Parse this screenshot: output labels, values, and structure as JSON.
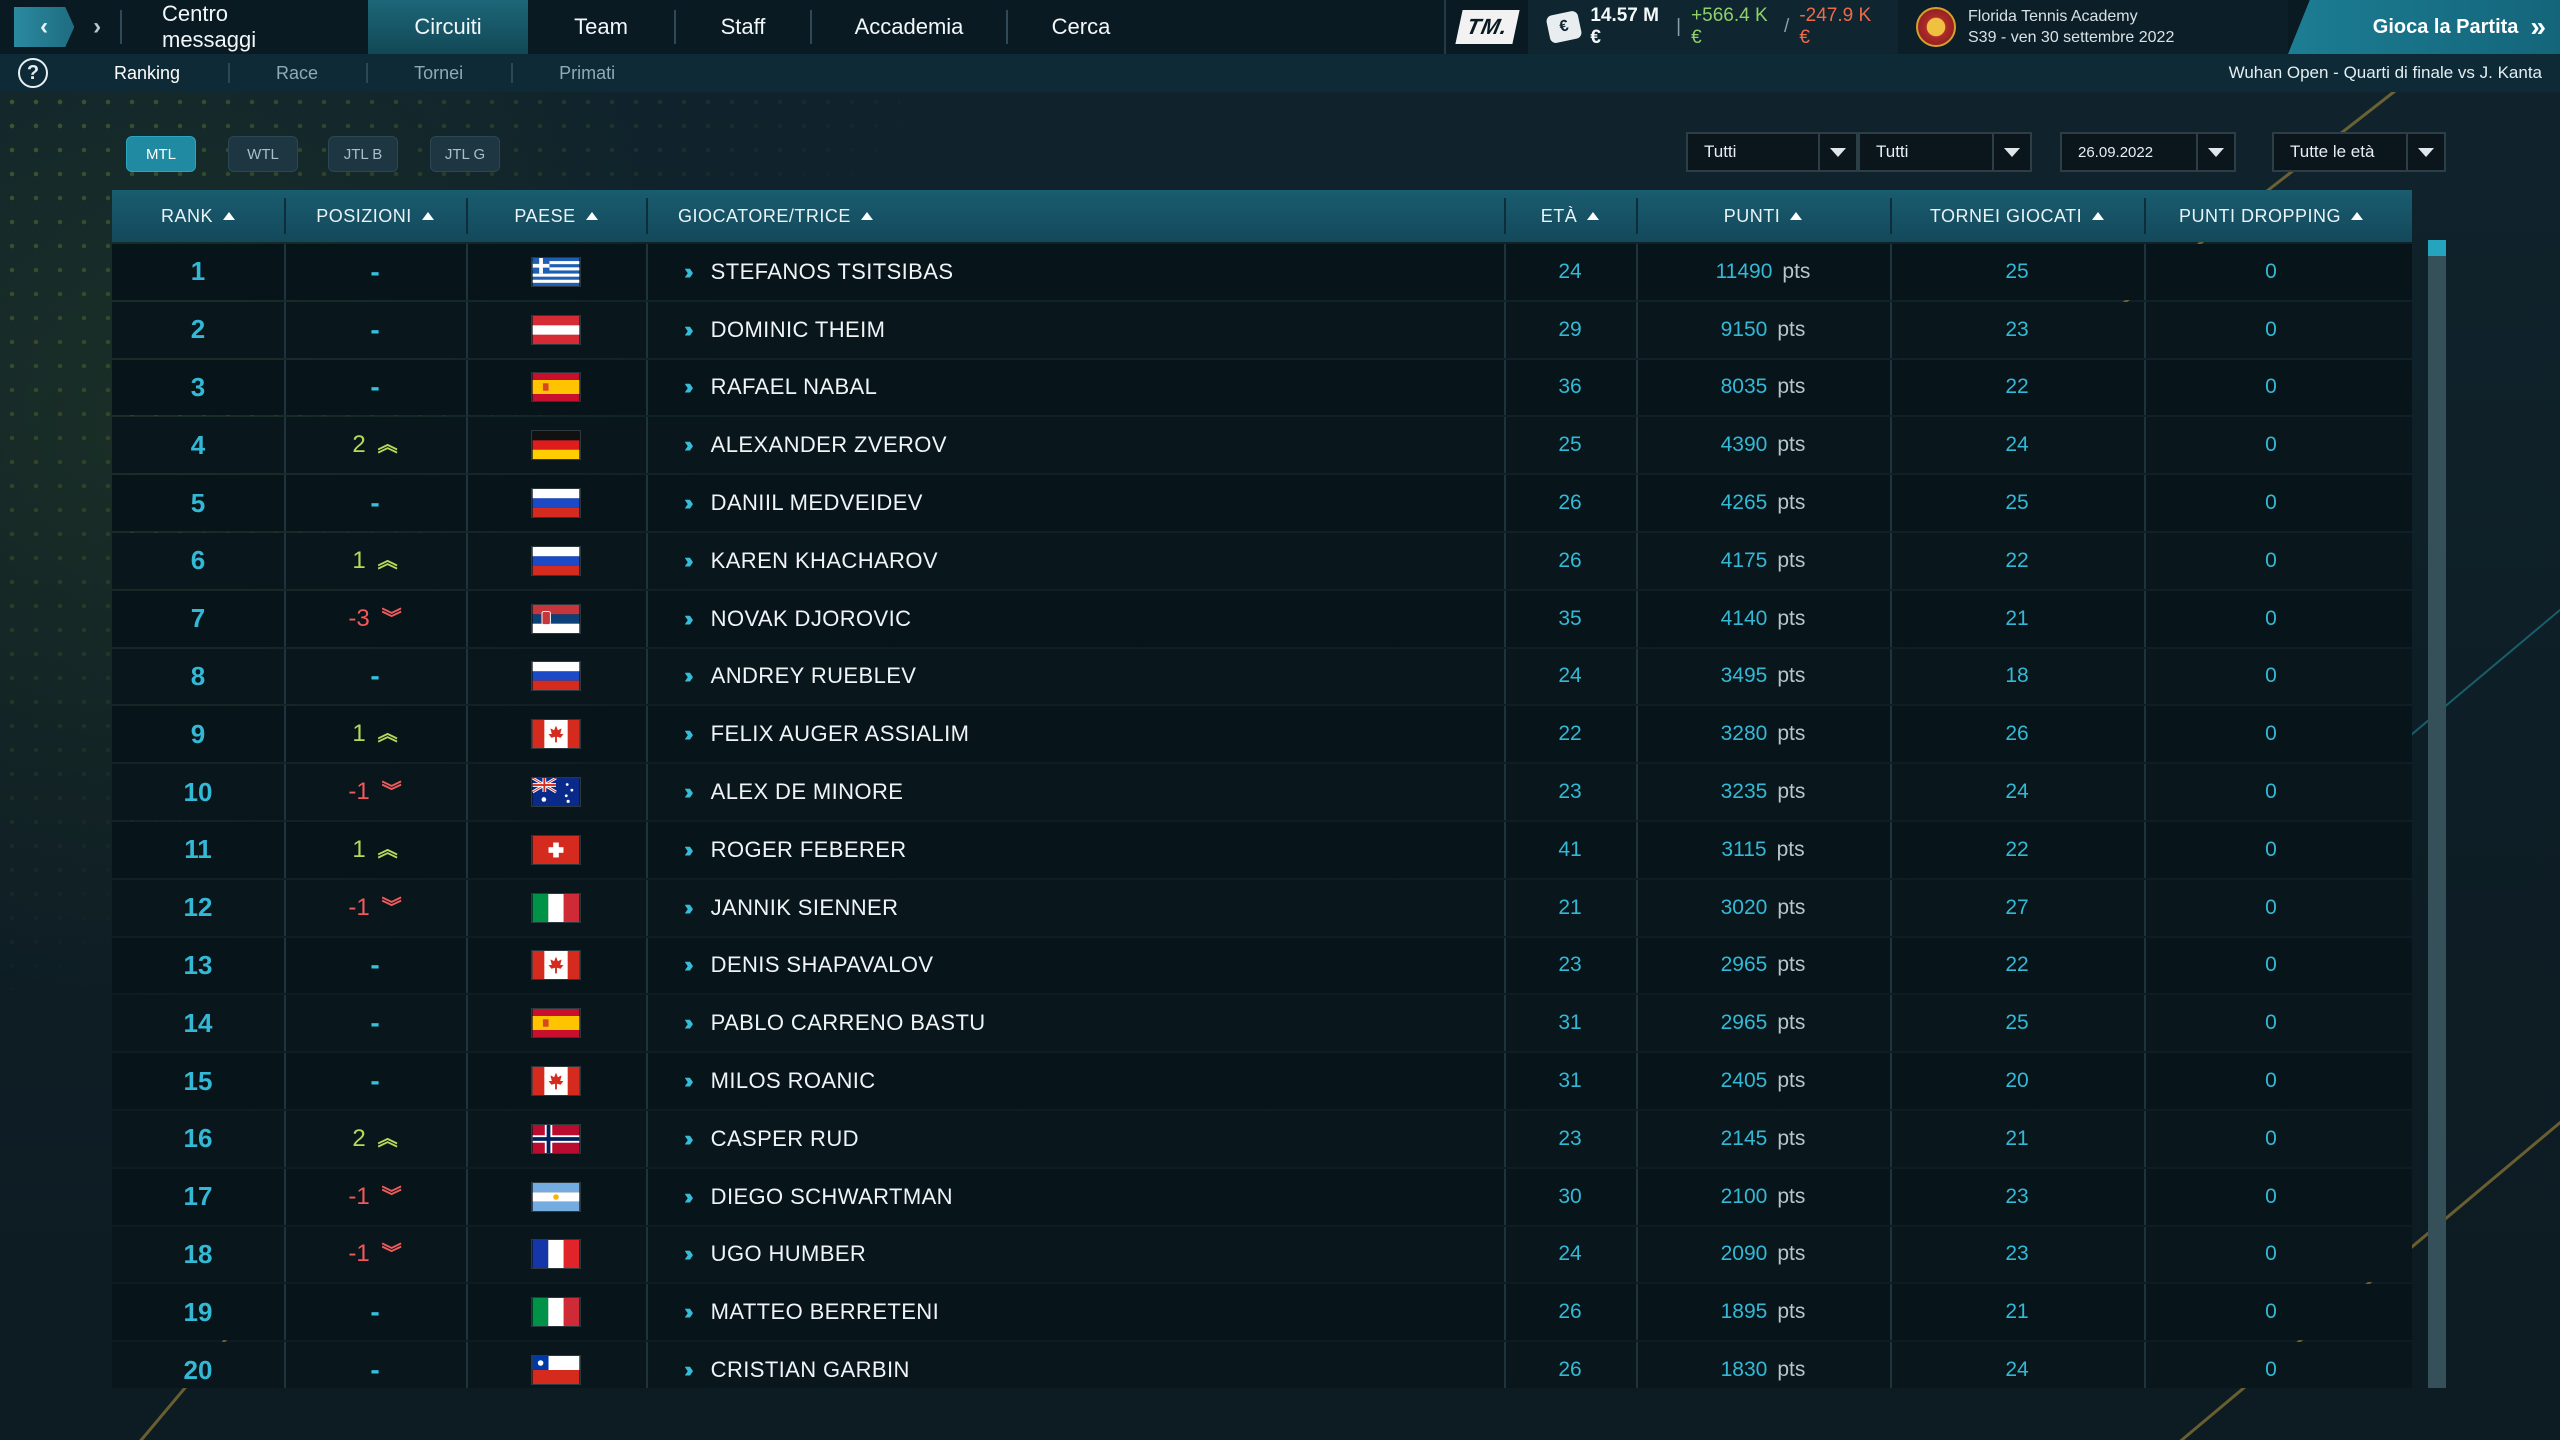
{
  "topbar": {
    "tabs": [
      {
        "label": "Centro messaggi",
        "active": false
      },
      {
        "label": "Circuiti",
        "active": true
      },
      {
        "label": "Team",
        "active": false
      },
      {
        "label": "Staff",
        "active": false
      },
      {
        "label": "Accademia",
        "active": false
      },
      {
        "label": "Cerca",
        "active": false
      }
    ],
    "logo_text": "TM.",
    "balance": "14.57 M €",
    "income": "+566.4 K €",
    "separator": "/",
    "expenses": "-247.9 K €",
    "academy_name": "Florida Tennis Academy",
    "date_line": "S39 - ven 30 settembre 2022",
    "play_label": "Gioca la Partita",
    "play_icon": "double-chevron-right-icon"
  },
  "subbar": {
    "help": "?",
    "tabs": [
      {
        "label": "Ranking",
        "active": true
      },
      {
        "label": "Race",
        "active": false
      },
      {
        "label": "Tornei",
        "active": false
      },
      {
        "label": "Primati",
        "active": false
      }
    ],
    "event": "Wuhan Open - Quarti di finale vs J. Kanta"
  },
  "filters": {
    "pills": [
      {
        "label": "MTL",
        "active": true
      },
      {
        "label": "WTL",
        "active": false
      },
      {
        "label": "JTL B",
        "active": false
      },
      {
        "label": "JTL G",
        "active": false
      }
    ],
    "dropdowns": [
      "Tutti",
      "Tutti",
      "26.09.2022",
      "Tutte le età"
    ]
  },
  "table": {
    "columns": [
      "RANK",
      "POSIZIONI",
      "PAESE",
      "GIOCATORE/TRICE",
      "ETÀ",
      "PUNTI",
      "TORNEI GIOCATI",
      "PUNTI DROPPING"
    ],
    "pts_unit": "pts",
    "rows": [
      {
        "rank": "1",
        "change": "-",
        "dir": "same",
        "flag": "GRC",
        "name": "STEFANOS TSITSIBAS",
        "age": "24",
        "points": "11490",
        "tournaments": "25",
        "dropping": "0"
      },
      {
        "rank": "2",
        "change": "-",
        "dir": "same",
        "flag": "AUT",
        "name": "DOMINIC THEIM",
        "age": "29",
        "points": "9150",
        "tournaments": "23",
        "dropping": "0"
      },
      {
        "rank": "3",
        "change": "-",
        "dir": "same",
        "flag": "ESP",
        "name": "RAFAEL NABAL",
        "age": "36",
        "points": "8035",
        "tournaments": "22",
        "dropping": "0"
      },
      {
        "rank": "4",
        "change": "2",
        "dir": "up",
        "flag": "DEU",
        "name": "ALEXANDER ZVEROV",
        "age": "25",
        "points": "4390",
        "tournaments": "24",
        "dropping": "0"
      },
      {
        "rank": "5",
        "change": "-",
        "dir": "same",
        "flag": "RUS",
        "name": "DANIIL MEDVEIDEV",
        "age": "26",
        "points": "4265",
        "tournaments": "25",
        "dropping": "0"
      },
      {
        "rank": "6",
        "change": "1",
        "dir": "up",
        "flag": "RUS",
        "name": "KAREN KHACHAROV",
        "age": "26",
        "points": "4175",
        "tournaments": "22",
        "dropping": "0"
      },
      {
        "rank": "7",
        "change": "-3",
        "dir": "down",
        "flag": "SRB",
        "name": "NOVAK DJOROVIC",
        "age": "35",
        "points": "4140",
        "tournaments": "21",
        "dropping": "0"
      },
      {
        "rank": "8",
        "change": "-",
        "dir": "same",
        "flag": "RUS",
        "name": "ANDREY RUEBLEV",
        "age": "24",
        "points": "3495",
        "tournaments": "18",
        "dropping": "0"
      },
      {
        "rank": "9",
        "change": "1",
        "dir": "up",
        "flag": "CAN",
        "name": "FELIX AUGER ASSIALIM",
        "age": "22",
        "points": "3280",
        "tournaments": "26",
        "dropping": "0"
      },
      {
        "rank": "10",
        "change": "-1",
        "dir": "down",
        "flag": "AUS",
        "name": "ALEX DE MINORE",
        "age": "23",
        "points": "3235",
        "tournaments": "24",
        "dropping": "0"
      },
      {
        "rank": "11",
        "change": "1",
        "dir": "up",
        "flag": "CHE",
        "name": "ROGER FEBERER",
        "age": "41",
        "points": "3115",
        "tournaments": "22",
        "dropping": "0"
      },
      {
        "rank": "12",
        "change": "-1",
        "dir": "down",
        "flag": "ITA",
        "name": "JANNIK SIENNER",
        "age": "21",
        "points": "3020",
        "tournaments": "27",
        "dropping": "0"
      },
      {
        "rank": "13",
        "change": "-",
        "dir": "same",
        "flag": "CAN",
        "name": "DENIS SHAPAVALOV",
        "age": "23",
        "points": "2965",
        "tournaments": "22",
        "dropping": "0"
      },
      {
        "rank": "14",
        "change": "-",
        "dir": "same",
        "flag": "ESP",
        "name": "PABLO CARRENO BASTU",
        "age": "31",
        "points": "2965",
        "tournaments": "25",
        "dropping": "0"
      },
      {
        "rank": "15",
        "change": "-",
        "dir": "same",
        "flag": "CAN",
        "name": "MILOS ROANIC",
        "age": "31",
        "points": "2405",
        "tournaments": "20",
        "dropping": "0"
      },
      {
        "rank": "16",
        "change": "2",
        "dir": "up",
        "flag": "NOR",
        "name": "CASPER RUD",
        "age": "23",
        "points": "2145",
        "tournaments": "21",
        "dropping": "0"
      },
      {
        "rank": "17",
        "change": "-1",
        "dir": "down",
        "flag": "ARG",
        "name": "DIEGO SCHWARTMAN",
        "age": "30",
        "points": "2100",
        "tournaments": "23",
        "dropping": "0"
      },
      {
        "rank": "18",
        "change": "-1",
        "dir": "down",
        "flag": "FRA",
        "name": "UGO HUMBER",
        "age": "24",
        "points": "2090",
        "tournaments": "23",
        "dropping": "0"
      },
      {
        "rank": "19",
        "change": "-",
        "dir": "same",
        "flag": "ITA",
        "name": "MATTEO BERRETENI",
        "age": "26",
        "points": "1895",
        "tournaments": "21",
        "dropping": "0"
      },
      {
        "rank": "20",
        "change": "-",
        "dir": "same",
        "flag": "CHL",
        "name": "CRISTIAN GARBIN",
        "age": "26",
        "points": "1830",
        "tournaments": "24",
        "dropping": "0"
      }
    ]
  },
  "colors": {
    "accent": "#1f8aa1",
    "rank_text": "#33b9d6",
    "up": "#b6d95a",
    "down": "#f05a5a",
    "income": "#8fd06a",
    "expense": "#f06a4a"
  }
}
